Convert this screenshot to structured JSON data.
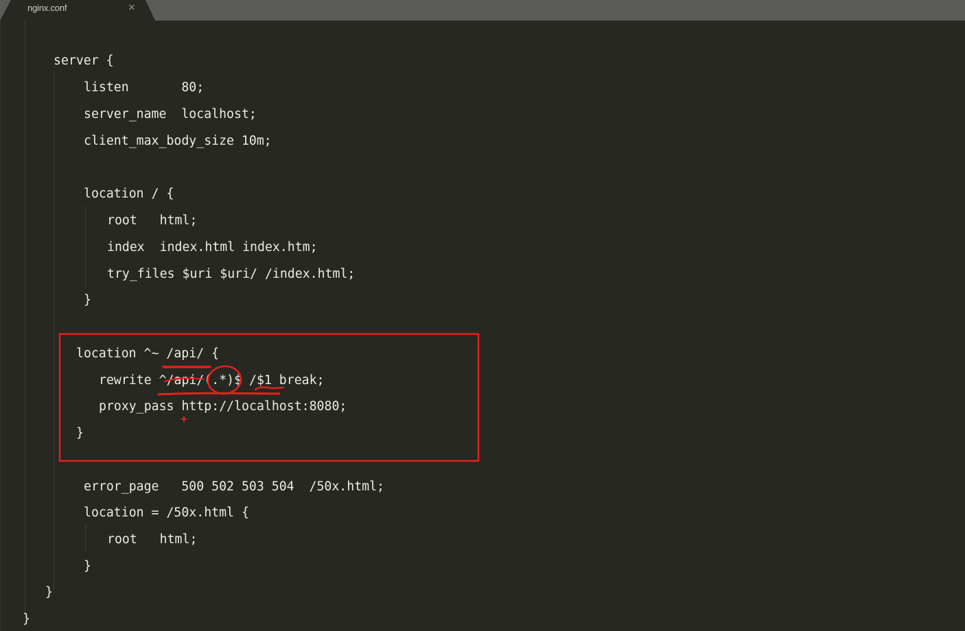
{
  "tab": {
    "title": "nginx.conf",
    "close_glyph": "×"
  },
  "colors": {
    "background": "#272822",
    "tabbar": "#5b5b58",
    "text": "#ececE6",
    "annotation": "#e8201c"
  },
  "code": {
    "lines": [
      "server {",
      "listen       80;",
      "server_name  localhost;",
      "client_max_body_size 10m;",
      "location / {",
      "root   html;",
      "index  index.html index.htm;",
      "try_files $uri $uri/ /index.html;",
      "}",
      "location ^~ /api/ {",
      "rewrite ^/api/(.*)$ /$1 break;",
      "proxy_pass http://localhost:8080;",
      "}",
      "error_page   500 502 503 504  /50x.html;",
      "location = /50x.html {",
      "root   html;",
      "}",
      "}",
      "}"
    ]
  }
}
